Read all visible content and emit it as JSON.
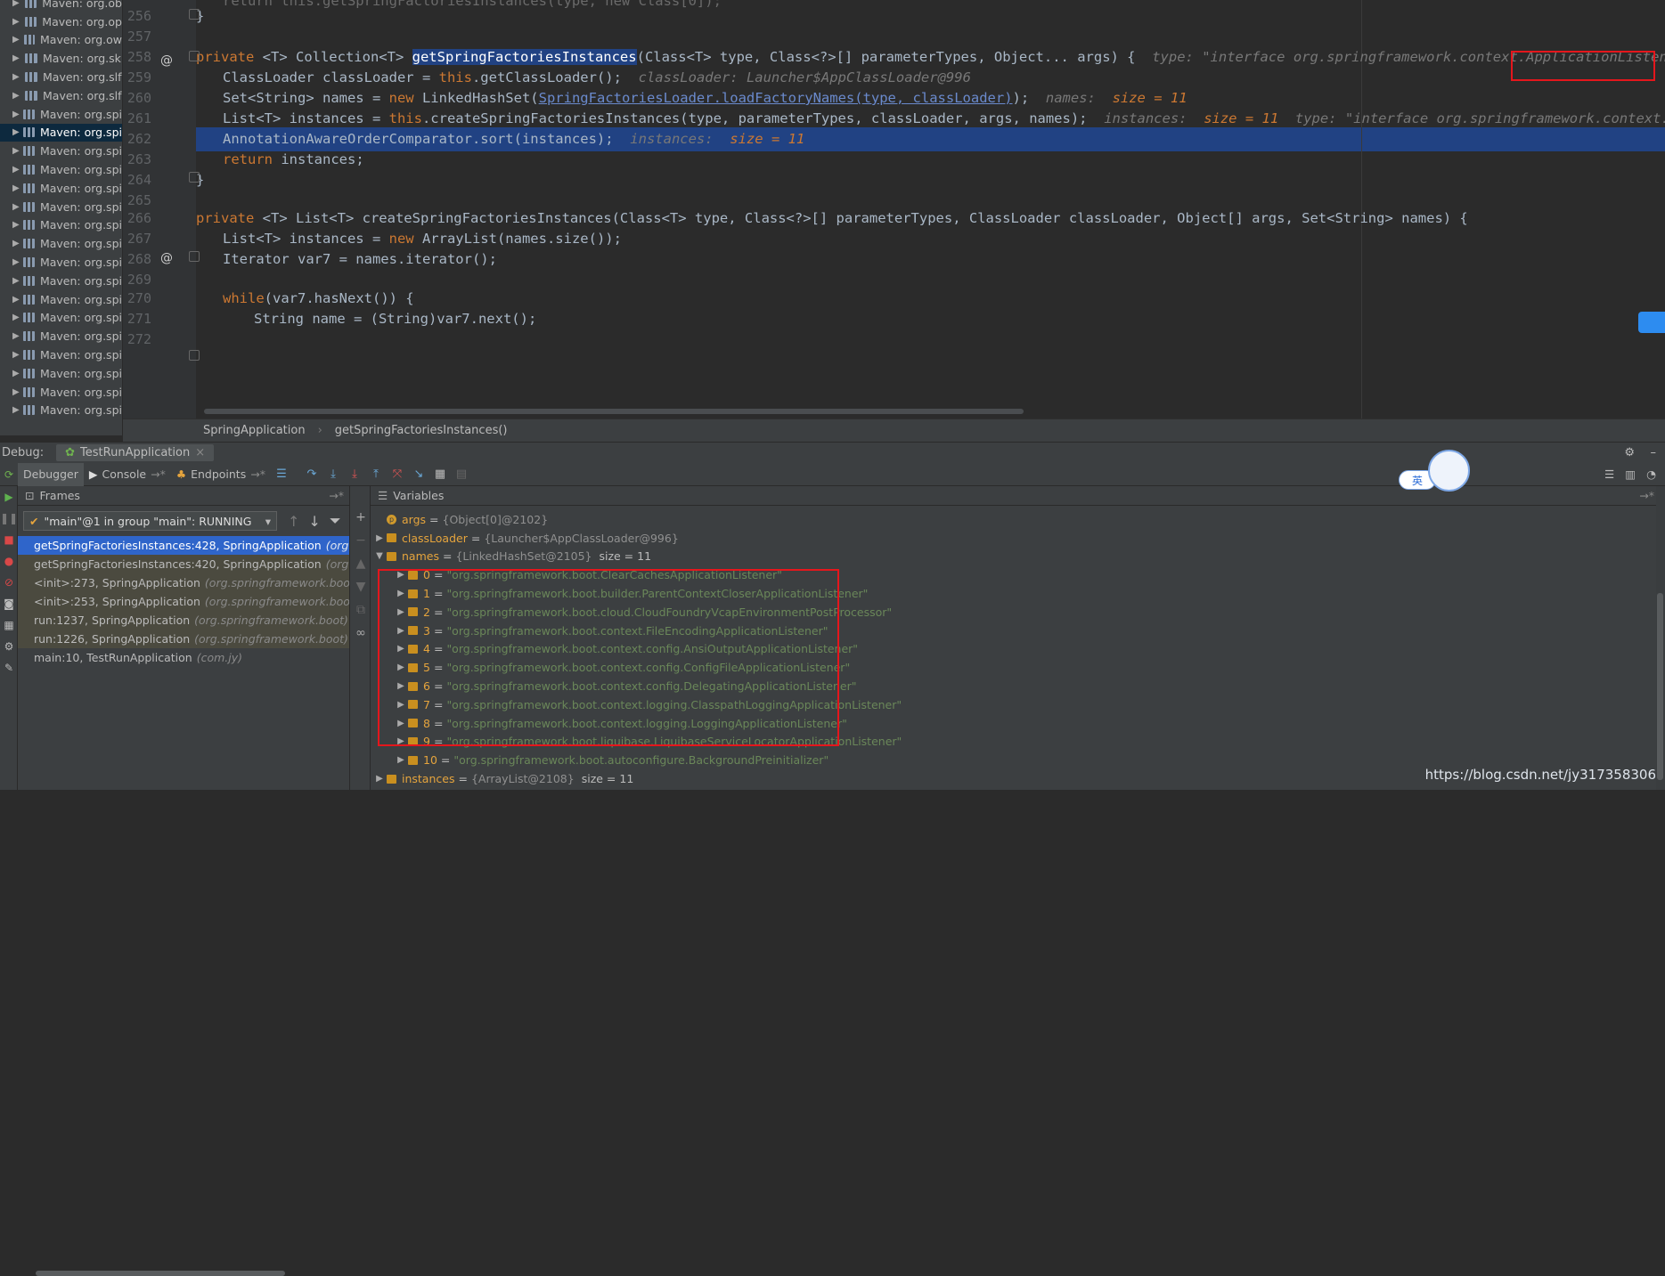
{
  "project_tree": [
    {
      "label": "Maven: org.ob"
    },
    {
      "label": "Maven: org.op"
    },
    {
      "label": "Maven: org.ow"
    },
    {
      "label": "Maven: org.sk"
    },
    {
      "label": "Maven: org.slf"
    },
    {
      "label": "Maven: org.slf"
    },
    {
      "label": "Maven: org.spi"
    },
    {
      "label": "Maven: org.spi",
      "selected": true
    },
    {
      "label": "Maven: org.spi"
    },
    {
      "label": "Maven: org.spi"
    },
    {
      "label": "Maven: org.spi"
    },
    {
      "label": "Maven: org.spi"
    },
    {
      "label": "Maven: org.spi"
    },
    {
      "label": "Maven: org.spi"
    },
    {
      "label": "Maven: org.spi"
    },
    {
      "label": "Maven: org.spi"
    },
    {
      "label": "Maven: org.spi"
    },
    {
      "label": "Maven: org.spi"
    },
    {
      "label": "Maven: org.spi"
    },
    {
      "label": "Maven: org.spi"
    },
    {
      "label": "Maven: org.spi"
    },
    {
      "label": "Maven: org.spi"
    },
    {
      "label": "Maven: org.spi"
    }
  ],
  "editor": {
    "line_numbers": [
      "256",
      "257",
      "258",
      "259",
      "260",
      "261",
      "262",
      "263",
      "264",
      "265",
      "266",
      "267",
      "268",
      "269",
      "270",
      "271",
      "272"
    ],
    "top_fragment": "return this.getSpringFactoriesInstances(type, new Class[0]);",
    "l256": "}",
    "l258_pre": "private ",
    "l258_sig1": "<T> Collection<T> ",
    "l258_method": "getSpringFactoriesInstances",
    "l258_sig2": "(Class<T> type, Class<?>[] parameterTypes, Object... args) {",
    "l258_hint": "type: \"interface org.springframework.context.ApplicationListener\"",
    "l259_code": "ClassLoader classLoader = ",
    "l259_kw": "this",
    "l259_rest": ".getClassLoader();",
    "l259_hint": "classLoader: Launcher$AppClassLoader@996",
    "l260_a": "Set<String> names = ",
    "l260_kw": "new",
    "l260_b": " LinkedHashSet(",
    "l260_u": "SpringFactoriesLoader.loadFactoryNames(type, classLoader)",
    "l260_c": ");",
    "l260_hint_a": "names:",
    "l260_hint_b": "size = 11",
    "l261_a": "List<T> instances = ",
    "l261_kw": "this",
    "l261_b": ".createSpringFactoriesInstances(type, parameterTypes, classLoader, args, names);",
    "l261_hint_a": "instances:",
    "l261_hint_b": "size = 11",
    "l261_hint_c": "type: \"interface org.springframework.context.",
    "l262_code": "AnnotationAwareOrderComparator.sort(instances);",
    "l262_hint_a": "instances:",
    "l262_hint_b": "size = 11",
    "l263_kw": "return",
    "l263_rest": " instances;",
    "l264": "}",
    "l266_pre": "private ",
    "l266_rest": "<T> List<T> createSpringFactoriesInstances(Class<T> type, Class<?>[] parameterTypes, ClassLoader classLoader, Object[] args, Set<String> names) {",
    "l267_a": "List<T> instances = ",
    "l267_kw": "new",
    "l267_b": " ArrayList(names.size());",
    "l268": "Iterator var7 = names.iterator();",
    "l270_kw": "while",
    "l270_rest": "(var7.hasNext()) {",
    "l271_a": "String name = (String)var7.next();"
  },
  "breadcrumb": [
    "SpringApplication",
    "getSpringFactoriesInstances()"
  ],
  "debug": {
    "label": "Debug:",
    "run_config": "TestRunApplication",
    "tabs": {
      "debugger": "Debugger",
      "console": "Console",
      "endpoints": "Endpoints"
    },
    "frames_title": "Frames",
    "variables_title": "Variables",
    "thread": "\"main\"@1 in group \"main\": RUNNING",
    "frames": [
      {
        "method": "getSpringFactoriesInstances:428, SpringApplication",
        "pkg": "(org.spri",
        "state": "selected"
      },
      {
        "method": "getSpringFactoriesInstances:420, SpringApplication",
        "pkg": "(org.spri",
        "state": "lib"
      },
      {
        "method": "<init>:273, SpringApplication",
        "pkg": "(org.springframework.boot)",
        "state": "lib"
      },
      {
        "method": "<init>:253, SpringApplication",
        "pkg": "(org.springframework.boot)",
        "state": "lib"
      },
      {
        "method": "run:1237, SpringApplication",
        "pkg": "(org.springframework.boot)",
        "state": "lib"
      },
      {
        "method": "run:1226, SpringApplication",
        "pkg": "(org.springframework.boot)",
        "state": "lib"
      },
      {
        "method": "main:10, TestRunApplication",
        "pkg": "(com.jy)",
        "state": "normal"
      }
    ],
    "variables": [
      {
        "name": "args",
        "ref": "{Object[0]@2102}",
        "indent": 0,
        "arrow": "",
        "kind": "p"
      },
      {
        "name": "classLoader",
        "ref": "{Launcher$AppClassLoader@996}",
        "indent": 0,
        "arrow": "▶",
        "kind": "f"
      },
      {
        "name": "names",
        "ref": "{LinkedHashSet@2105}",
        "size": "size = 11",
        "indent": 0,
        "arrow": "▼",
        "kind": "f"
      },
      {
        "name": "0",
        "str": "\"org.springframework.boot.ClearCachesApplicationListener\"",
        "indent": 1,
        "arrow": "▶",
        "kind": "f"
      },
      {
        "name": "1",
        "str": "\"org.springframework.boot.builder.ParentContextCloserApplicationListener\"",
        "indent": 1,
        "arrow": "▶",
        "kind": "f"
      },
      {
        "name": "2",
        "str": "\"org.springframework.boot.cloud.CloudFoundryVcapEnvironmentPostProcessor\"",
        "indent": 1,
        "arrow": "▶",
        "kind": "f"
      },
      {
        "name": "3",
        "str": "\"org.springframework.boot.context.FileEncodingApplicationListener\"",
        "indent": 1,
        "arrow": "▶",
        "kind": "f"
      },
      {
        "name": "4",
        "str": "\"org.springframework.boot.context.config.AnsiOutputApplicationListener\"",
        "indent": 1,
        "arrow": "▶",
        "kind": "f"
      },
      {
        "name": "5",
        "str": "\"org.springframework.boot.context.config.ConfigFileApplicationListener\"",
        "indent": 1,
        "arrow": "▶",
        "kind": "f"
      },
      {
        "name": "6",
        "str": "\"org.springframework.boot.context.config.DelegatingApplicationListener\"",
        "indent": 1,
        "arrow": "▶",
        "kind": "f"
      },
      {
        "name": "7",
        "str": "\"org.springframework.boot.context.logging.ClasspathLoggingApplicationListener\"",
        "indent": 1,
        "arrow": "▶",
        "kind": "f"
      },
      {
        "name": "8",
        "str": "\"org.springframework.boot.context.logging.LoggingApplicationListener\"",
        "indent": 1,
        "arrow": "▶",
        "kind": "f"
      },
      {
        "name": "9",
        "str": "\"org.springframework.boot.liquibase.LiquibaseServiceLocatorApplicationListener\"",
        "indent": 1,
        "arrow": "▶",
        "kind": "f"
      },
      {
        "name": "10",
        "str": "\"org.springframework.boot.autoconfigure.BackgroundPreinitializer\"",
        "indent": 1,
        "arrow": "▶",
        "kind": "f"
      },
      {
        "name": "instances",
        "ref": "{ArrayList@2108}",
        "size": "size = 11",
        "indent": 0,
        "arrow": "▶",
        "kind": "f"
      }
    ]
  },
  "overlay": {
    "lang_pill": "英"
  },
  "watermark": "https://blog.csdn.net/jy317358306",
  "colors": {
    "keyword": "#cc7832",
    "string": "#6a8759",
    "selection": "#2f65ca",
    "highlight": "#214283",
    "annotation": "#e5161c"
  }
}
